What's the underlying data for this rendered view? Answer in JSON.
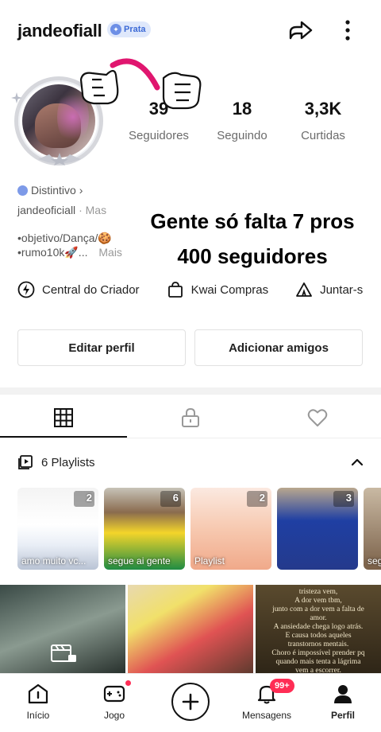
{
  "profile": {
    "username": "jandeofiall",
    "tier_badge": "Prata",
    "stats": [
      {
        "value": "39",
        "label": "Seguidores"
      },
      {
        "value": "18",
        "label": "Seguindo"
      },
      {
        "value": "3,3K",
        "label": "Curtidas"
      }
    ],
    "distintivo_label": "Distintivo",
    "bio_handle": "jandeoficiall",
    "bio_mais_1": "Mas",
    "bio_line_1": "•objetivo/Dança/🍪",
    "bio_line_2": "•rumo10k🚀...",
    "bio_mais_2": "Mais"
  },
  "overlay": {
    "line1": "Gente só falta 7 pros",
    "line2": "400 seguidores"
  },
  "shortcuts": [
    {
      "label": "Central do Criador",
      "icon": "lightning-icon"
    },
    {
      "label": "Kwai Compras",
      "icon": "shopping-bag-icon"
    },
    {
      "label": "Juntar-s",
      "icon": "tent-icon"
    }
  ],
  "buttons": {
    "edit_profile": "Editar perfil",
    "add_friends": "Adicionar amigos"
  },
  "tabs": [
    {
      "icon": "grid-icon",
      "active": true
    },
    {
      "icon": "lock-icon",
      "active": false
    },
    {
      "icon": "heart-icon",
      "active": false
    }
  ],
  "playlists": {
    "header": "6 Playlists",
    "items": [
      {
        "count": "2",
        "title": "amo muito vc..."
      },
      {
        "count": "6",
        "title": "segue ai gente"
      },
      {
        "count": "2",
        "title": "Playlist"
      },
      {
        "count": "3",
        "title": ""
      },
      {
        "count": "",
        "title": "seg Bor"
      }
    ]
  },
  "quote_text": "tristeza vem,\nA dor vem tbm,\njunto com a dor vem a falta de\namor.\nA ansiedade chega logo atrás.\nE causa todos aqueles\ntranstornos mentais.\nChoro é impossível prender pq\nquando mais tenta a lágrima\nvem a escorrer.",
  "bottom_nav": {
    "inicio": "Início",
    "jogo": "Jogo",
    "mensagens": "Mensagens",
    "perfil": "Perfil",
    "notif_badge": "99+"
  },
  "colors": {
    "badge_bg": "#dfe8fb",
    "badge_text": "#3c6ad6",
    "notif_red": "#ff2d55",
    "arrow_pink": "#e0166f"
  }
}
